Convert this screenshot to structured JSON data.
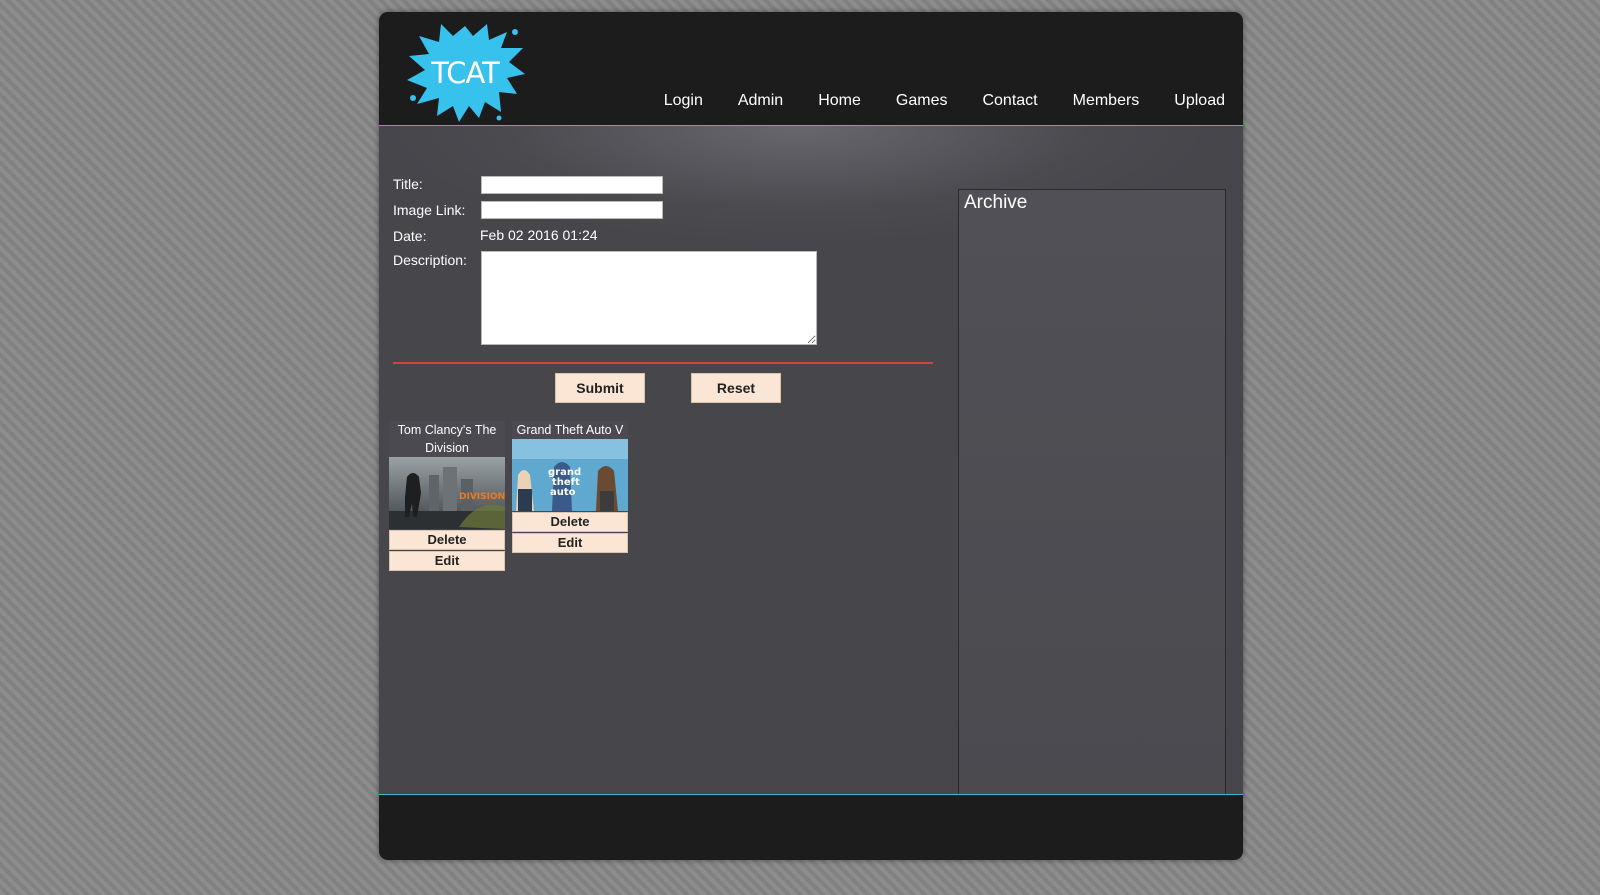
{
  "brand": {
    "logo_text": "TCAT",
    "accent_color": "#3fb6d8",
    "logo_color": "#37c2ee"
  },
  "nav": {
    "items": [
      "Login",
      "Admin",
      "Home",
      "Games",
      "Contact",
      "Members",
      "Upload"
    ]
  },
  "form": {
    "title_label": "Title:",
    "title_value": "",
    "image_link_label": "Image Link:",
    "image_link_value": "",
    "date_label": "Date:",
    "date_value": "Feb 02 2016 01:24",
    "description_label": "Description:",
    "description_value": "",
    "submit_label": "Submit",
    "reset_label": "Reset"
  },
  "games": [
    {
      "title": "Tom Clancy's The Division",
      "image_icon": "division-cover-image",
      "delete_label": "Delete",
      "edit_label": "Edit"
    },
    {
      "title": "Grand Theft Auto V",
      "image_icon": "gta-v-cover-image",
      "delete_label": "Delete",
      "edit_label": "Edit"
    }
  ],
  "archive": {
    "title": "Archive"
  },
  "colors": {
    "divider": "#c9473c",
    "button_bg": "#fbe6d6",
    "header_bg": "#1c1c1d",
    "content_bg": "#46464b"
  }
}
